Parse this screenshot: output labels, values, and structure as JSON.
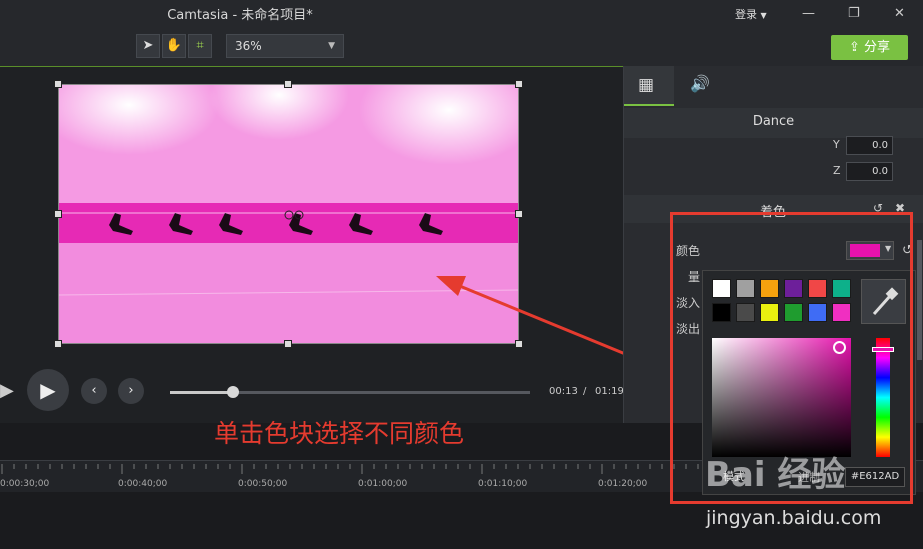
{
  "titlebar": {
    "title": "Camtasia - 未命名项目*",
    "login_label": "登录",
    "share_label": "分享",
    "zoom_value": "36%"
  },
  "tools": [
    "arrow-icon",
    "hand-icon",
    "crop-icon"
  ],
  "canvas": {
    "tint_color": "#e612ad"
  },
  "playback": {
    "current_time": "00:13",
    "separator": "/",
    "total_time": "01:19",
    "progress": 0.16
  },
  "annotation": "单击色块选择不同颜色",
  "timeline": {
    "ticks": [
      "0:00:30;00",
      "0:00:40;00",
      "0:00:50;00",
      "0:01:00;00",
      "0:01:10;00",
      "0:01:20;00"
    ]
  },
  "panel": {
    "clip_name": "Dance",
    "y_label": "Y",
    "y_value": "0.0",
    "z_label": "Z",
    "z_value": "0.0",
    "effect_name": "着色",
    "color_label": "颜色",
    "amount_label": "量",
    "fade_in_label": "淡入",
    "fade_out_label": "淡出"
  },
  "color_picker": {
    "swatches": [
      "#ffffff",
      "#a0a0a0",
      "#f5a10e",
      "#6d1f9a",
      "#f04747",
      "#0db08a",
      "#000000",
      "#4a4a4a",
      "#e9f00f",
      "#1f9c2f",
      "#3f6cf5",
      "#f02fc1"
    ],
    "mode_label": "模式",
    "hex_label": "进制",
    "hex_value": "#E612AD",
    "current_color": "#e612ad"
  },
  "watermark": {
    "logo": "Bai 经验",
    "url": "jingyan.baidu.com"
  }
}
